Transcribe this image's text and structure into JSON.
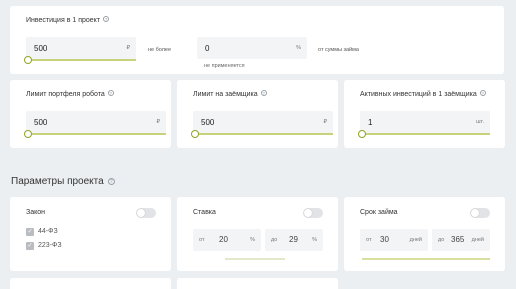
{
  "investment": {
    "title": "Инвестиция в 1 проект",
    "amount": "500",
    "amount_unit": "₽",
    "no_more_than": "не более",
    "percent_value": "0",
    "percent_unit": "%",
    "percent_suffix": "от суммы займа",
    "not_applied": "не применяется"
  },
  "limits": [
    {
      "label": "Лимит портфеля робота",
      "value": "500",
      "unit": "₽"
    },
    {
      "label": "Лимит на заёмщика",
      "value": "500",
      "unit": "₽"
    },
    {
      "label": "Активных инвестиций в 1 заёмщика",
      "value": "1",
      "unit": "шт."
    }
  ],
  "project_params": {
    "title": "Параметры проекта",
    "law": {
      "label": "Закон",
      "options": [
        "44-ФЗ",
        "223-ФЗ"
      ],
      "enabled": false
    },
    "rate": {
      "label": "Ставка",
      "from_prefix": "от",
      "from": "20",
      "to_prefix": "до",
      "to": "29",
      "unit": "%",
      "enabled": false
    },
    "term": {
      "label": "Срок займа",
      "from_prefix": "от",
      "from": "30",
      "to_prefix": "до",
      "to": "365",
      "unit": "дней",
      "enabled": false
    }
  },
  "colors": {
    "accent": "#8ea624",
    "background": "#eceff2",
    "card": "#ffffff"
  }
}
